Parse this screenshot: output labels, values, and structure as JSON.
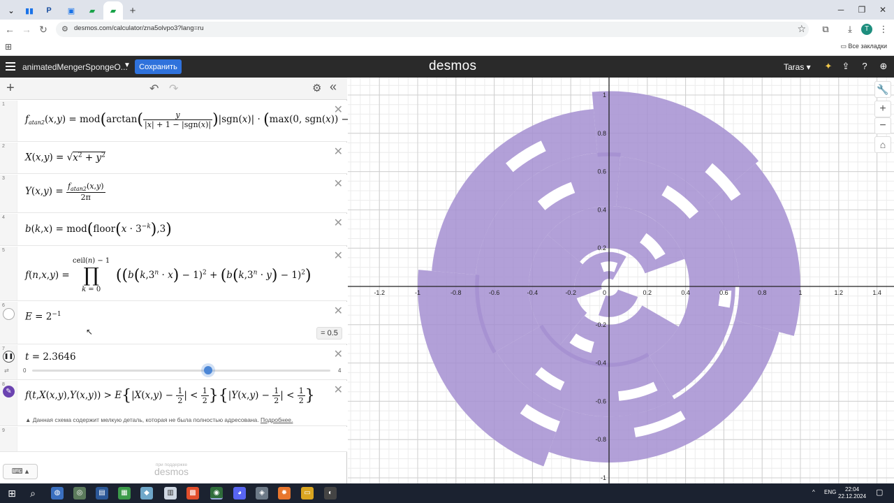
{
  "browser": {
    "url": "desmos.com/calculator/zna5olvpo3?lang=ru",
    "bookmarks_all": "Все закладки",
    "profile_initial": "T",
    "tab_p_label": "P"
  },
  "header": {
    "graph_title": "animatedMengerSpongeO...",
    "save_label": "Сохранить",
    "logo": "desmos",
    "user": "Taras"
  },
  "expressions": [
    {
      "num": "1"
    },
    {
      "num": "2"
    },
    {
      "num": "3"
    },
    {
      "num": "4"
    },
    {
      "num": "5"
    },
    {
      "num": "6",
      "value_pill": "= 0.5"
    },
    {
      "num": "7",
      "slider": {
        "min": "0",
        "max": "4",
        "value": 2.3646,
        "value_text": "2.3646",
        "fraction": 0.591
      }
    },
    {
      "num": "8",
      "warning": "Данная схема содержит мелкую деталь, которая не была полностью адресована.",
      "warning_link": "Подробнее."
    },
    {
      "num": "9"
    }
  ],
  "footer": {
    "powered_small": "при поддержке",
    "powered_logo": "desmos"
  },
  "graph": {
    "x_ticks": [
      "-1.2",
      "-1",
      "-0.8",
      "-0.6",
      "-0.4",
      "-0.2",
      "0",
      "0.2",
      "0.4",
      "0.6",
      "0.8",
      "1",
      "1.2",
      "1.4"
    ],
    "y_ticks": [
      "1",
      "0.8",
      "0.6",
      "0.4",
      "0.2",
      "-0.2",
      "-0.4",
      "-0.6",
      "-0.8",
      "-1"
    ],
    "fill_color": "#a58fd1"
  },
  "taskbar": {
    "lang": "ENG",
    "time": "22:04",
    "date": "22.12.2024"
  },
  "colors": {
    "desmos_header": "#2a2a2a",
    "save_button": "#2f72dc",
    "region": "#a58fd1"
  }
}
